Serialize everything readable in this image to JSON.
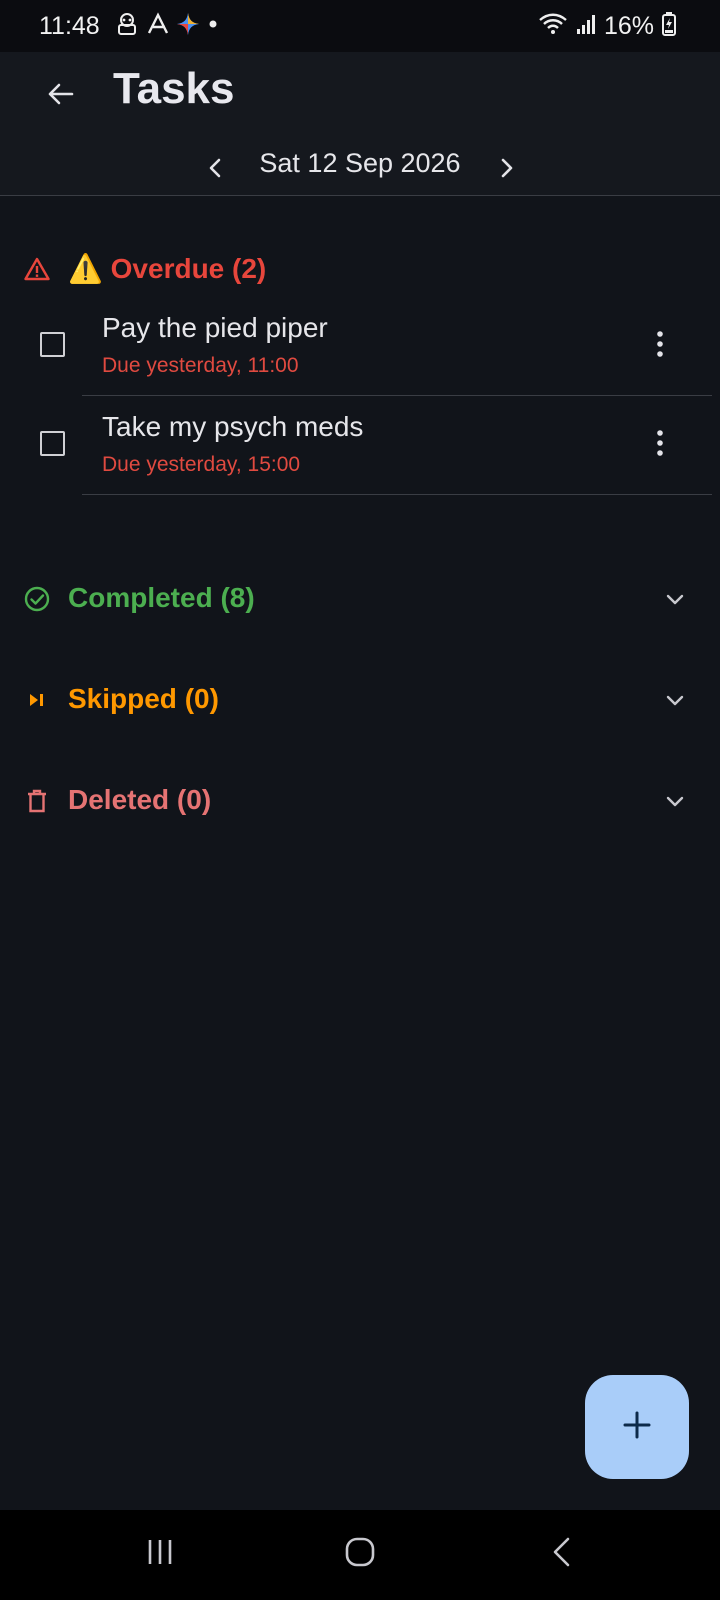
{
  "status_bar": {
    "time": "11:48",
    "battery": "16%",
    "icons_left": [
      "robot-icon",
      "arrow-logo-icon",
      "gemini-sparkle-icon",
      "dot-icon"
    ],
    "icons_right": [
      "wifi-icon",
      "signal-icon",
      "battery-charging-icon"
    ]
  },
  "header": {
    "title": "Tasks",
    "back_icon": "arrow-left-icon"
  },
  "date_nav": {
    "date": "Sat 12 Sep 2026",
    "prev_icon": "chevron-left-icon",
    "next_icon": "chevron-right-icon"
  },
  "sections": {
    "overdue": {
      "title": "⚠️ Overdue (2)",
      "color": "#e8463c",
      "icon": "warning-triangle-icon"
    },
    "completed": {
      "title": "Completed (8)",
      "color": "#4caf50",
      "icon": "check-circle-icon"
    },
    "skipped": {
      "title": "Skipped (0)",
      "color": "#ff9800",
      "icon": "skip-next-icon"
    },
    "deleted": {
      "title": "Deleted (0)",
      "color": "#e57373",
      "icon": "trash-icon"
    }
  },
  "overdue_tasks": [
    {
      "title": "Pay the pied piper",
      "due": "Due yesterday, 11:00"
    },
    {
      "title": "Take my psych meds",
      "due": "Due yesterday, 15:00"
    }
  ],
  "fab": {
    "icon": "plus-icon",
    "color": "#a9cdf9"
  },
  "nav_bar": {
    "buttons": [
      "recent-apps-icon",
      "home-icon",
      "back-icon"
    ]
  }
}
